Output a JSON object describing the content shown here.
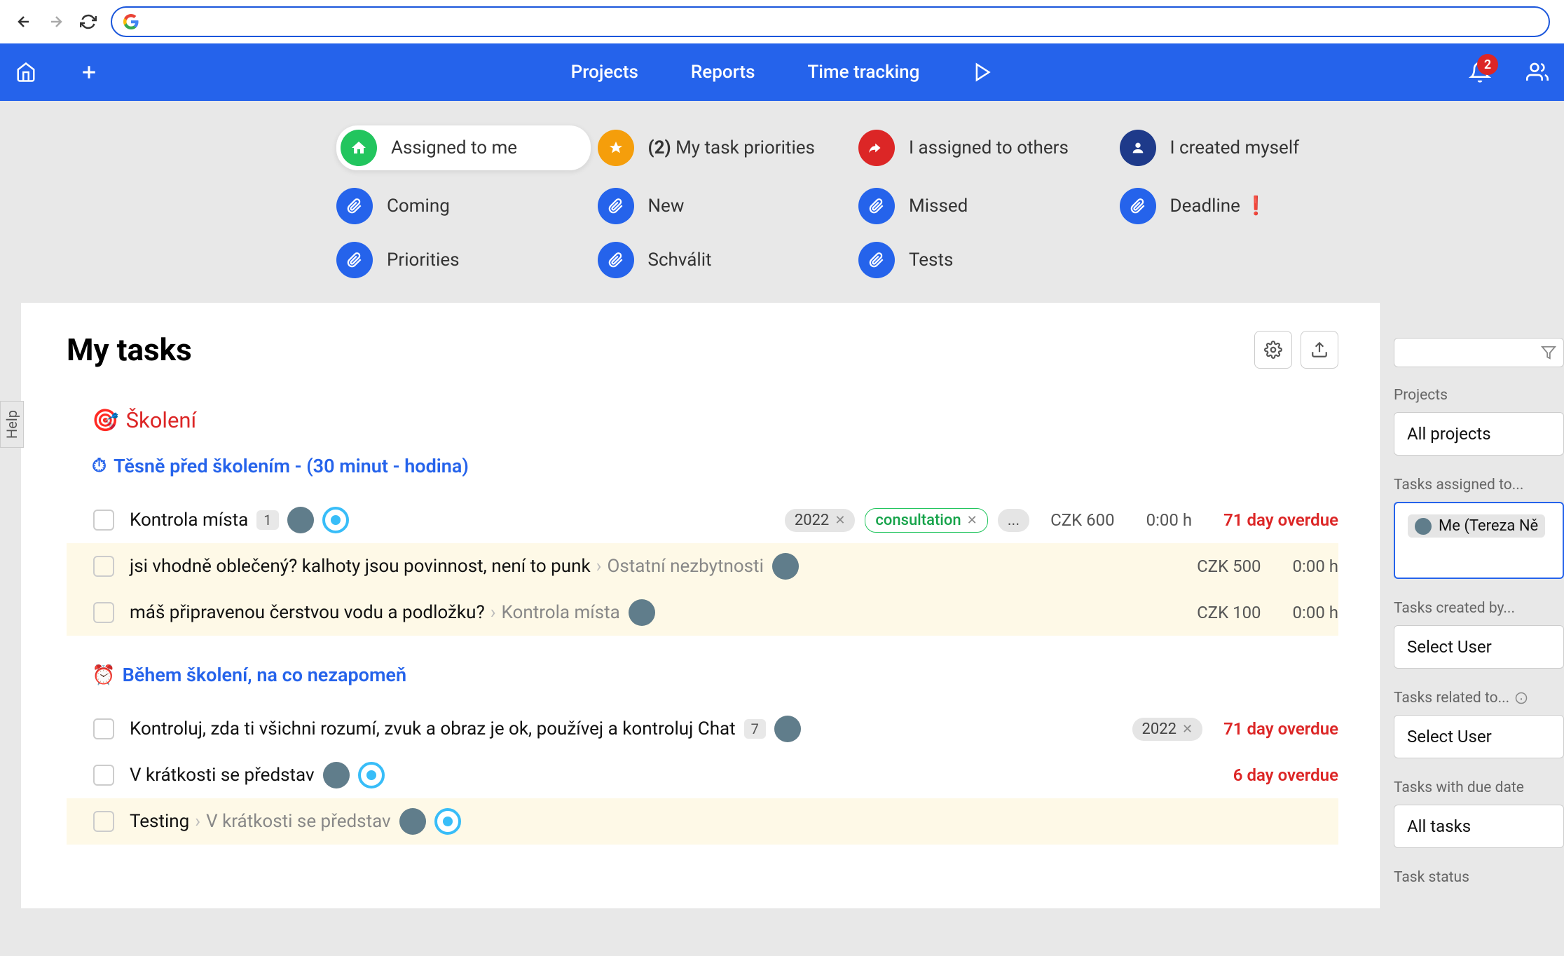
{
  "browser": {
    "url": ""
  },
  "header": {
    "nav": {
      "projects": "Projects",
      "reports": "Reports",
      "time_tracking": "Time tracking"
    },
    "badge_count": "2"
  },
  "filters": {
    "row1": {
      "assigned": "Assigned to me",
      "priorities_count": "(2)",
      "priorities_label": "My task priorities",
      "assigned_others": "I assigned to others",
      "created": "I created myself"
    },
    "row2": {
      "coming": "Coming",
      "new": "New",
      "missed": "Missed",
      "deadline": "Deadline"
    },
    "row3": {
      "priorities": "Priorities",
      "schvalit": "Schválit",
      "tests": "Tests"
    }
  },
  "page": {
    "title": "My tasks"
  },
  "sections": {
    "skoleni": {
      "title": "Školení",
      "icon": "🎯"
    },
    "tesne": {
      "title": "Těsně před školením - (30 minut - hodina)",
      "icon": "⏱"
    },
    "behem": {
      "title": "Během školení, na co nezapomeň",
      "icon": "⏰"
    }
  },
  "tasks": {
    "t1": {
      "title": "Kontrola místa",
      "count": "1",
      "tag_year": "2022",
      "tag_consultation": "consultation",
      "tag_more": "...",
      "price": "CZK 600",
      "time": "0:00 h",
      "overdue": "71 day overdue"
    },
    "t2": {
      "title": "jsi vhodně oblečený? kalhoty jsou povinnost, není to punk",
      "breadcrumb": "Ostatní nezbytnosti",
      "price": "CZK 500",
      "time": "0:00 h"
    },
    "t3": {
      "title": "máš připravenou čerstvou vodu a podložku?",
      "breadcrumb": "Kontrola místa",
      "price": "CZK 100",
      "time": "0:00 h"
    },
    "t4": {
      "title": "Kontroluj, zda ti všichni rozumí, zvuk a obraz je ok, používej a kontroluj Chat",
      "count": "7",
      "tag_year": "2022",
      "overdue": "71 day overdue"
    },
    "t5": {
      "title": "V krátkosti se představ",
      "overdue": "6 day overdue"
    },
    "t6": {
      "title": "Testing",
      "breadcrumb": "V krátkosti se představ"
    }
  },
  "sidebar": {
    "projects_label": "Projects",
    "projects_value": "All projects",
    "assigned_label": "Tasks assigned to...",
    "assigned_value": "Me (Tereza Ně",
    "created_label": "Tasks created by...",
    "created_value": "Select User",
    "related_label": "Tasks related to...",
    "related_value": "Select User",
    "duedate_label": "Tasks with due date",
    "duedate_value": "All tasks",
    "status_label": "Task status"
  },
  "help": "Help"
}
